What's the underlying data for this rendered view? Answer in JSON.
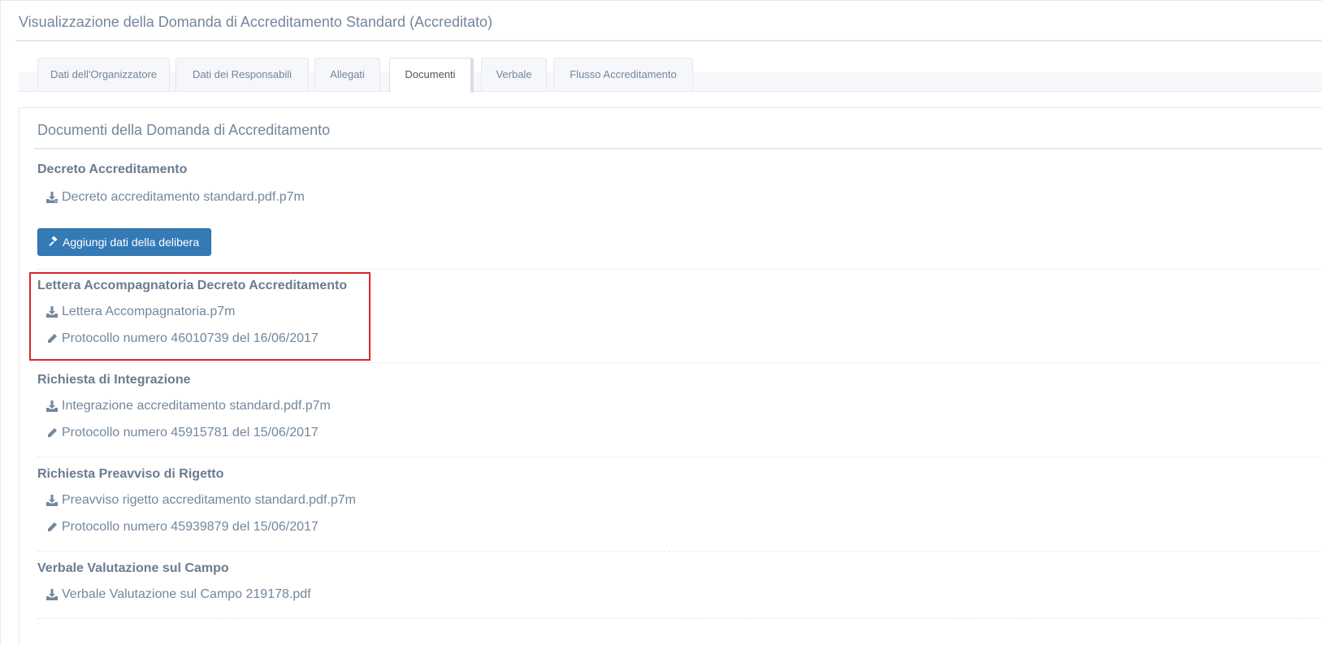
{
  "header": {
    "title": "Visualizzazione della Domanda di Accreditamento Standard (Accreditato)"
  },
  "tabs": [
    {
      "label": "Dati dell'Organizzatore",
      "active": false
    },
    {
      "label": "Dati dei Responsabili",
      "active": false
    },
    {
      "label": "Allegati",
      "active": false
    },
    {
      "label": "Documenti",
      "active": true
    },
    {
      "label": "Verbale",
      "active": false
    },
    {
      "label": "Flusso Accreditamento",
      "active": false
    }
  ],
  "panel": {
    "title": "Documenti della Domanda di Accreditamento",
    "sections": [
      {
        "title": "Decreto Accreditamento",
        "file": "Decreto accreditamento standard.pdf.p7m",
        "button_label": "Aggiungi dati della delibera"
      },
      {
        "title": "Lettera Accompagnatoria Decreto Accreditamento",
        "file": "Lettera Accompagnatoria.p7m",
        "protocol": "Protocollo numero 46010739 del 16/06/2017"
      },
      {
        "title": "Richiesta di Integrazione",
        "file": "Integrazione accreditamento standard.pdf.p7m",
        "protocol": "Protocollo numero 45915781 del 15/06/2017"
      },
      {
        "title": "Richiesta Preavviso di Rigetto",
        "file": "Preavviso rigetto accreditamento standard.pdf.p7m",
        "protocol": "Protocollo numero 45939879 del 15/06/2017"
      },
      {
        "title": "Verbale Valutazione sul Campo",
        "file": "Verbale Valutazione sul Campo 219178.pdf"
      }
    ]
  },
  "colors": {
    "primary_button": "#337ab7",
    "highlight_border": "#d9262f",
    "text": "#73879c"
  },
  "icons": {
    "download": "download-icon",
    "pencil": "pencil-icon",
    "gavel": "gavel-icon"
  }
}
